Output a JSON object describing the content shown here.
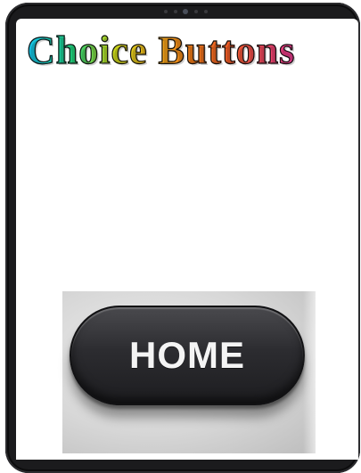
{
  "screen": {
    "title": "Choice Buttons"
  },
  "home_button": {
    "label": "HOME"
  },
  "colors": {
    "device_frame": "#1b1b1d",
    "screen_background": "#ffffff",
    "button_face": "#2c2c30",
    "button_text": "#f4f4f4",
    "title_gradient": [
      "#12c3f0",
      "#1fd27a",
      "#c6d81a",
      "#f2b11a",
      "#f07a18",
      "#f05a28",
      "#e83a80",
      "#c83ae8"
    ]
  }
}
